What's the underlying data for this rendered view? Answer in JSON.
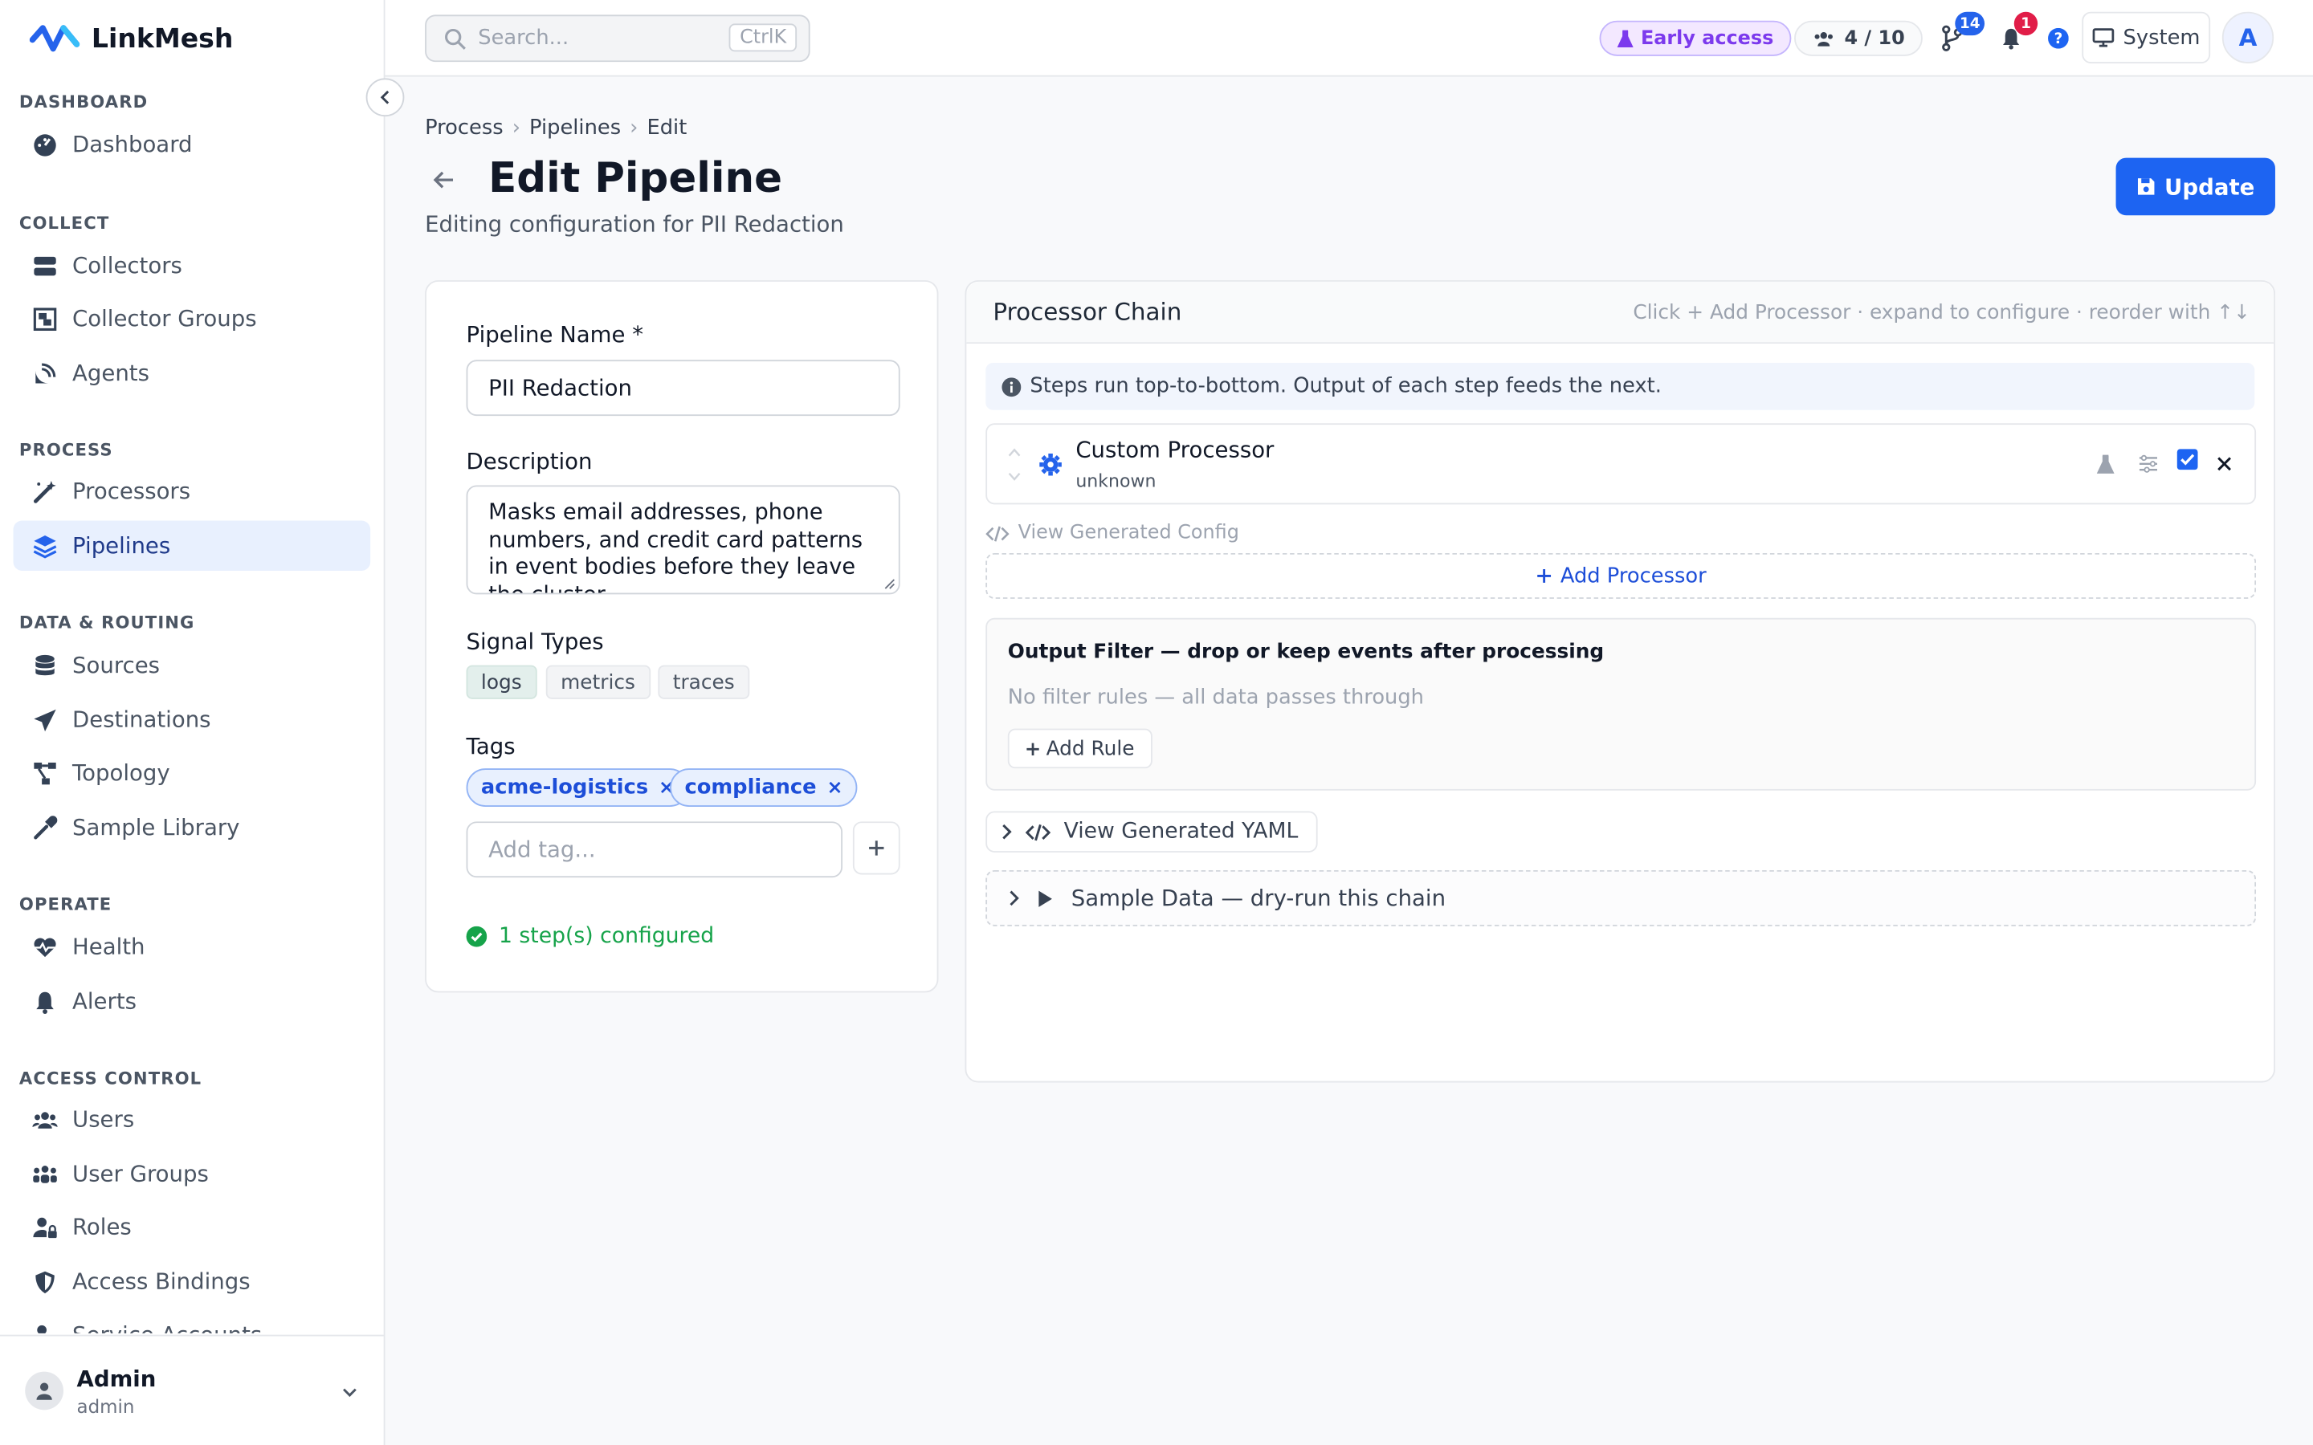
{
  "app": {
    "name": "LinkMesh"
  },
  "search": {
    "placeholder": "Search...",
    "shortcut": "CtrlK"
  },
  "topbar": {
    "early_access": "Early access",
    "seats": "4 / 10",
    "git_badge": "14",
    "notif_badge": "1",
    "theme": "System",
    "avatar_initial": "A"
  },
  "sidebar": {
    "sections": {
      "dashboard": "DASHBOARD",
      "collect": "COLLECT",
      "process": "PROCESS",
      "data_routing": "DATA & ROUTING",
      "operate": "OPERATE",
      "access_control": "ACCESS CONTROL"
    },
    "items": {
      "dashboard": "Dashboard",
      "collectors": "Collectors",
      "collector_groups": "Collector Groups",
      "agents": "Agents",
      "processors": "Processors",
      "pipelines": "Pipelines",
      "sources": "Sources",
      "destinations": "Destinations",
      "topology": "Topology",
      "sample_library": "Sample Library",
      "health": "Health",
      "alerts": "Alerts",
      "users": "Users",
      "user_groups": "User Groups",
      "roles": "Roles",
      "access_bindings": "Access Bindings",
      "service_accounts": "Service Accounts"
    },
    "user": {
      "name": "Admin",
      "role": "admin"
    }
  },
  "breadcrumb": [
    "Process",
    "Pipelines",
    "Edit"
  ],
  "page": {
    "title": "Edit Pipeline",
    "subtitle": "Editing configuration for PII Redaction",
    "update_label": "Update"
  },
  "form": {
    "name_label": "Pipeline Name *",
    "name_value": "PII Redaction",
    "desc_label": "Description",
    "desc_value": "Masks email addresses, phone numbers, and credit card patterns in event bodies before they leave the cluster.",
    "signal_label": "Signal Types",
    "signals": [
      "logs",
      "metrics",
      "traces"
    ],
    "tags_label": "Tags",
    "tags": [
      "acme-logistics",
      "compliance"
    ],
    "tag_placeholder": "Add tag...",
    "status": "1 step(s) configured"
  },
  "chain": {
    "title": "Processor Chain",
    "hint": "Click + Add Processor · expand to configure · reorder with ↑↓",
    "info": "Steps run top-to-bottom. Output of each step feeds the next.",
    "processor": {
      "name": "Custom Processor",
      "type": "unknown"
    },
    "view_config": "View Generated Config",
    "add_processor": "Add Processor",
    "output_filter_title": "Output Filter — drop or keep events after processing",
    "no_rules": "No filter rules — all data passes through",
    "add_rule": "Add Rule",
    "view_yaml": "View Generated YAML",
    "sample_data": "Sample Data — dry-run this chain"
  },
  "colors": {
    "accent": "#1d64f2",
    "success": "#16a34a",
    "early": "#7c3aed",
    "danger": "#e11d48"
  }
}
